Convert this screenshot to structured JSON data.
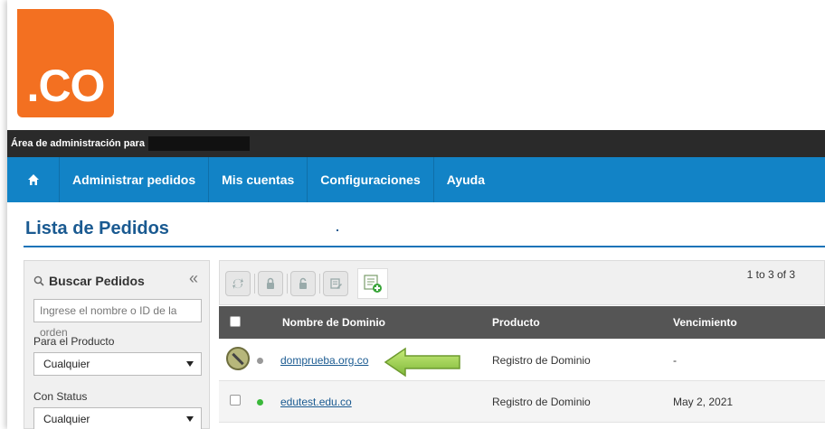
{
  "logo": {
    "text": ".CO",
    "color": "#f37021"
  },
  "admin_bar": {
    "label": "Área de administración para"
  },
  "nav": {
    "home_icon": "home-icon",
    "items": [
      {
        "label": "Administrar pedidos"
      },
      {
        "label": "Mis cuentas"
      },
      {
        "label": "Configuraciones"
      },
      {
        "label": "Ayuda"
      }
    ]
  },
  "page": {
    "title": "Lista de Pedidos"
  },
  "sidebar": {
    "heading": "Buscar Pedidos",
    "collapse_glyph": "«",
    "search_placeholder": "Ingrese el nombre o ID de la orden",
    "product_label": "Para el Producto",
    "product_value": "Cualquier",
    "status_label": "Con Status",
    "status_value": "Cualquier"
  },
  "toolbar": {
    "pager": "1 to 3 of 3",
    "icons": [
      "refresh-icon",
      "lock-icon",
      "unlock-icon",
      "edit-icon",
      "add-list-icon"
    ]
  },
  "table": {
    "headers": [
      "Nombre de Dominio",
      "Producto",
      "Vencimiento"
    ],
    "rows": [
      {
        "domain": "domprueba.org.co",
        "product": "Registro de Dominio",
        "expiry": "-",
        "status_color": "#999999",
        "status_icon": "ban-icon"
      },
      {
        "domain": "edutest.edu.co",
        "product": "Registro de Dominio",
        "expiry": "May 2, 2021",
        "status_color": "#3ab83a"
      }
    ]
  },
  "colors": {
    "nav": "#1283c6",
    "title": "#1a5a91",
    "header_row": "#555555",
    "arrow": "#9acd4c"
  }
}
